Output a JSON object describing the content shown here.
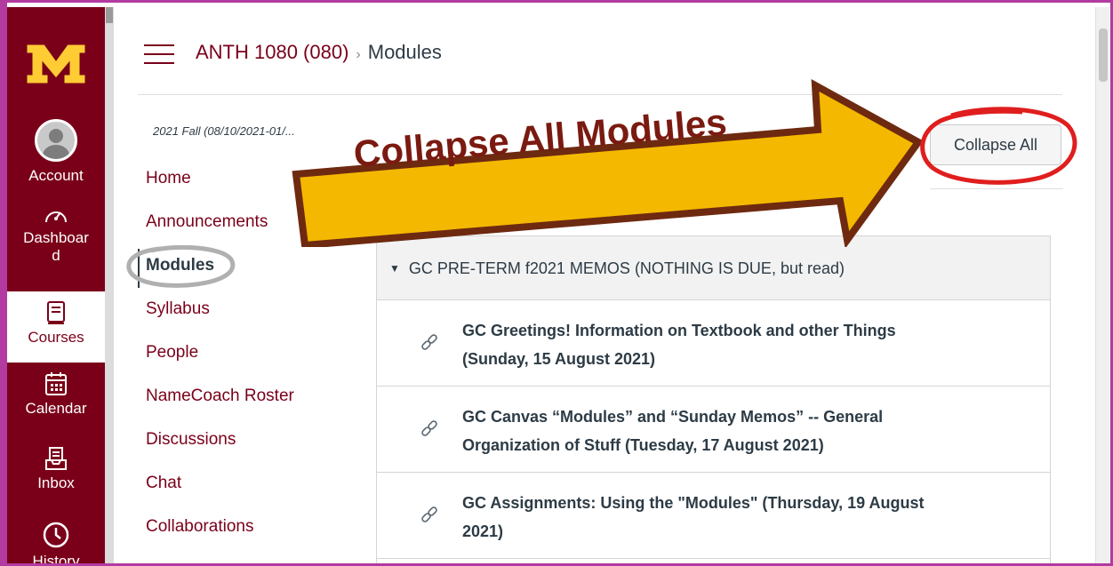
{
  "global_nav": {
    "items": [
      {
        "label": "Account",
        "icon": "avatar-icon"
      },
      {
        "label": "Dashboard",
        "icon": "dashboard-icon"
      },
      {
        "label": "Courses",
        "icon": "courses-icon",
        "active": true
      },
      {
        "label": "Calendar",
        "icon": "calendar-icon"
      },
      {
        "label": "Inbox",
        "icon": "inbox-icon"
      },
      {
        "label": "History",
        "icon": "history-icon"
      }
    ],
    "brand_color": "#7a0019",
    "logo_color": "#ffcc33"
  },
  "header": {
    "course": "ANTH 1080 (080)",
    "separator": "›",
    "current": "Modules"
  },
  "term": "2021 Fall (08/10/2021-01/...",
  "course_nav": {
    "items": [
      {
        "label": "Home"
      },
      {
        "label": "Announcements"
      },
      {
        "label": "Modules",
        "active": true
      },
      {
        "label": "Syllabus"
      },
      {
        "label": "People"
      },
      {
        "label": "NameCoach Roster"
      },
      {
        "label": "Discussions"
      },
      {
        "label": "Chat"
      },
      {
        "label": "Collaborations"
      }
    ]
  },
  "toolbar": {
    "collapse_all": "Collapse All"
  },
  "annotation": {
    "callout_text": "Collapse All Modules",
    "arrow_color": "#f5b800"
  },
  "module": {
    "title": "GC PRE-TERM f2021 MEMOS (NOTHING IS DUE, but read)",
    "items": [
      {
        "title_line1": "GC Greetings! Information on Textbook and other Things",
        "title_line2": "(Sunday, 15 August 2021)",
        "icon": "link-icon"
      },
      {
        "title_line1": "GC Canvas “Modules” and “Sunday Memos” -- General",
        "title_line2": "Organization of Stuff (Tuesday, 17 August 2021)",
        "icon": "link-icon"
      },
      {
        "title_line1": "GC Assignments: Using the \"Modules\" (Thursday, 19 August",
        "title_line2": "2021)",
        "icon": "link-icon"
      }
    ]
  }
}
